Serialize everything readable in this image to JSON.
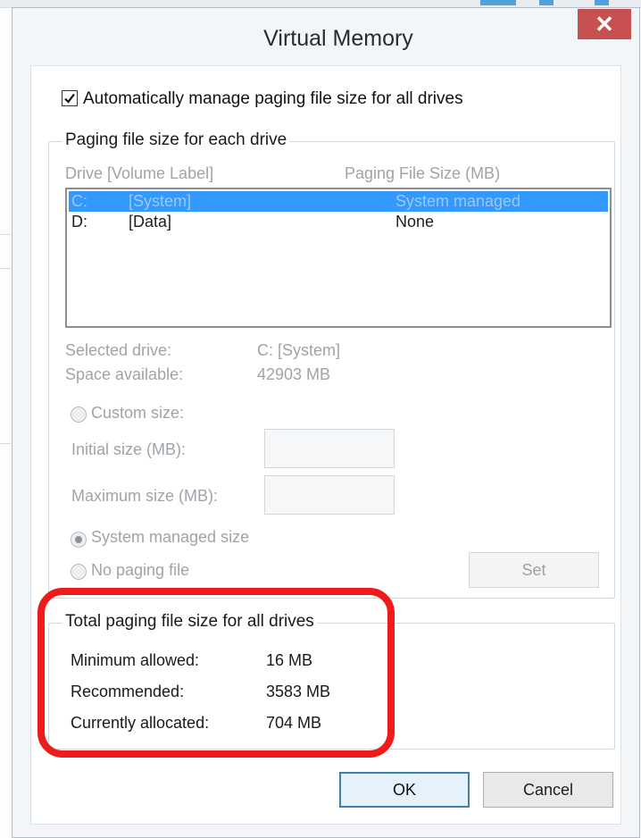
{
  "window": {
    "title": "Virtual Memory",
    "close_glyph": "✕"
  },
  "auto_manage": {
    "checked": true,
    "label": "Automatically manage paging file size for all drives"
  },
  "drives_group": {
    "legend": "Paging file size for each drive",
    "columns": [
      "Drive  [Volume Label]",
      "Paging File Size (MB)"
    ],
    "rows": [
      {
        "drive": "C:",
        "label": "[System]",
        "size": "System managed",
        "selected": true
      },
      {
        "drive": "D:",
        "label": "[Data]",
        "size": "None",
        "selected": false
      }
    ],
    "selected_drive_label": "Selected drive:",
    "selected_drive_value": "C:  [System]",
    "space_available_label": "Space available:",
    "space_available_value": "42903 MB",
    "custom_size_label": "Custom size:",
    "initial_size_label": "Initial size (MB):",
    "initial_size_value": "",
    "maximum_size_label": "Maximum size (MB):",
    "maximum_size_value": "",
    "system_managed_label": "System managed size",
    "no_paging_label": "No paging file",
    "set_label": "Set",
    "selected_option": "System managed size"
  },
  "totals_group": {
    "legend": "Total paging file size for all drives",
    "minimum_label": "Minimum allowed:",
    "minimum_value": "16 MB",
    "recommended_label": "Recommended:",
    "recommended_value": "3583 MB",
    "allocated_label": "Currently allocated:",
    "allocated_value": "704 MB"
  },
  "buttons": {
    "ok_label": "OK",
    "cancel_label": "Cancel"
  },
  "colors": {
    "highlight": "#ef1a1a",
    "selection": "#3399ff",
    "close_button": "#c75050"
  }
}
